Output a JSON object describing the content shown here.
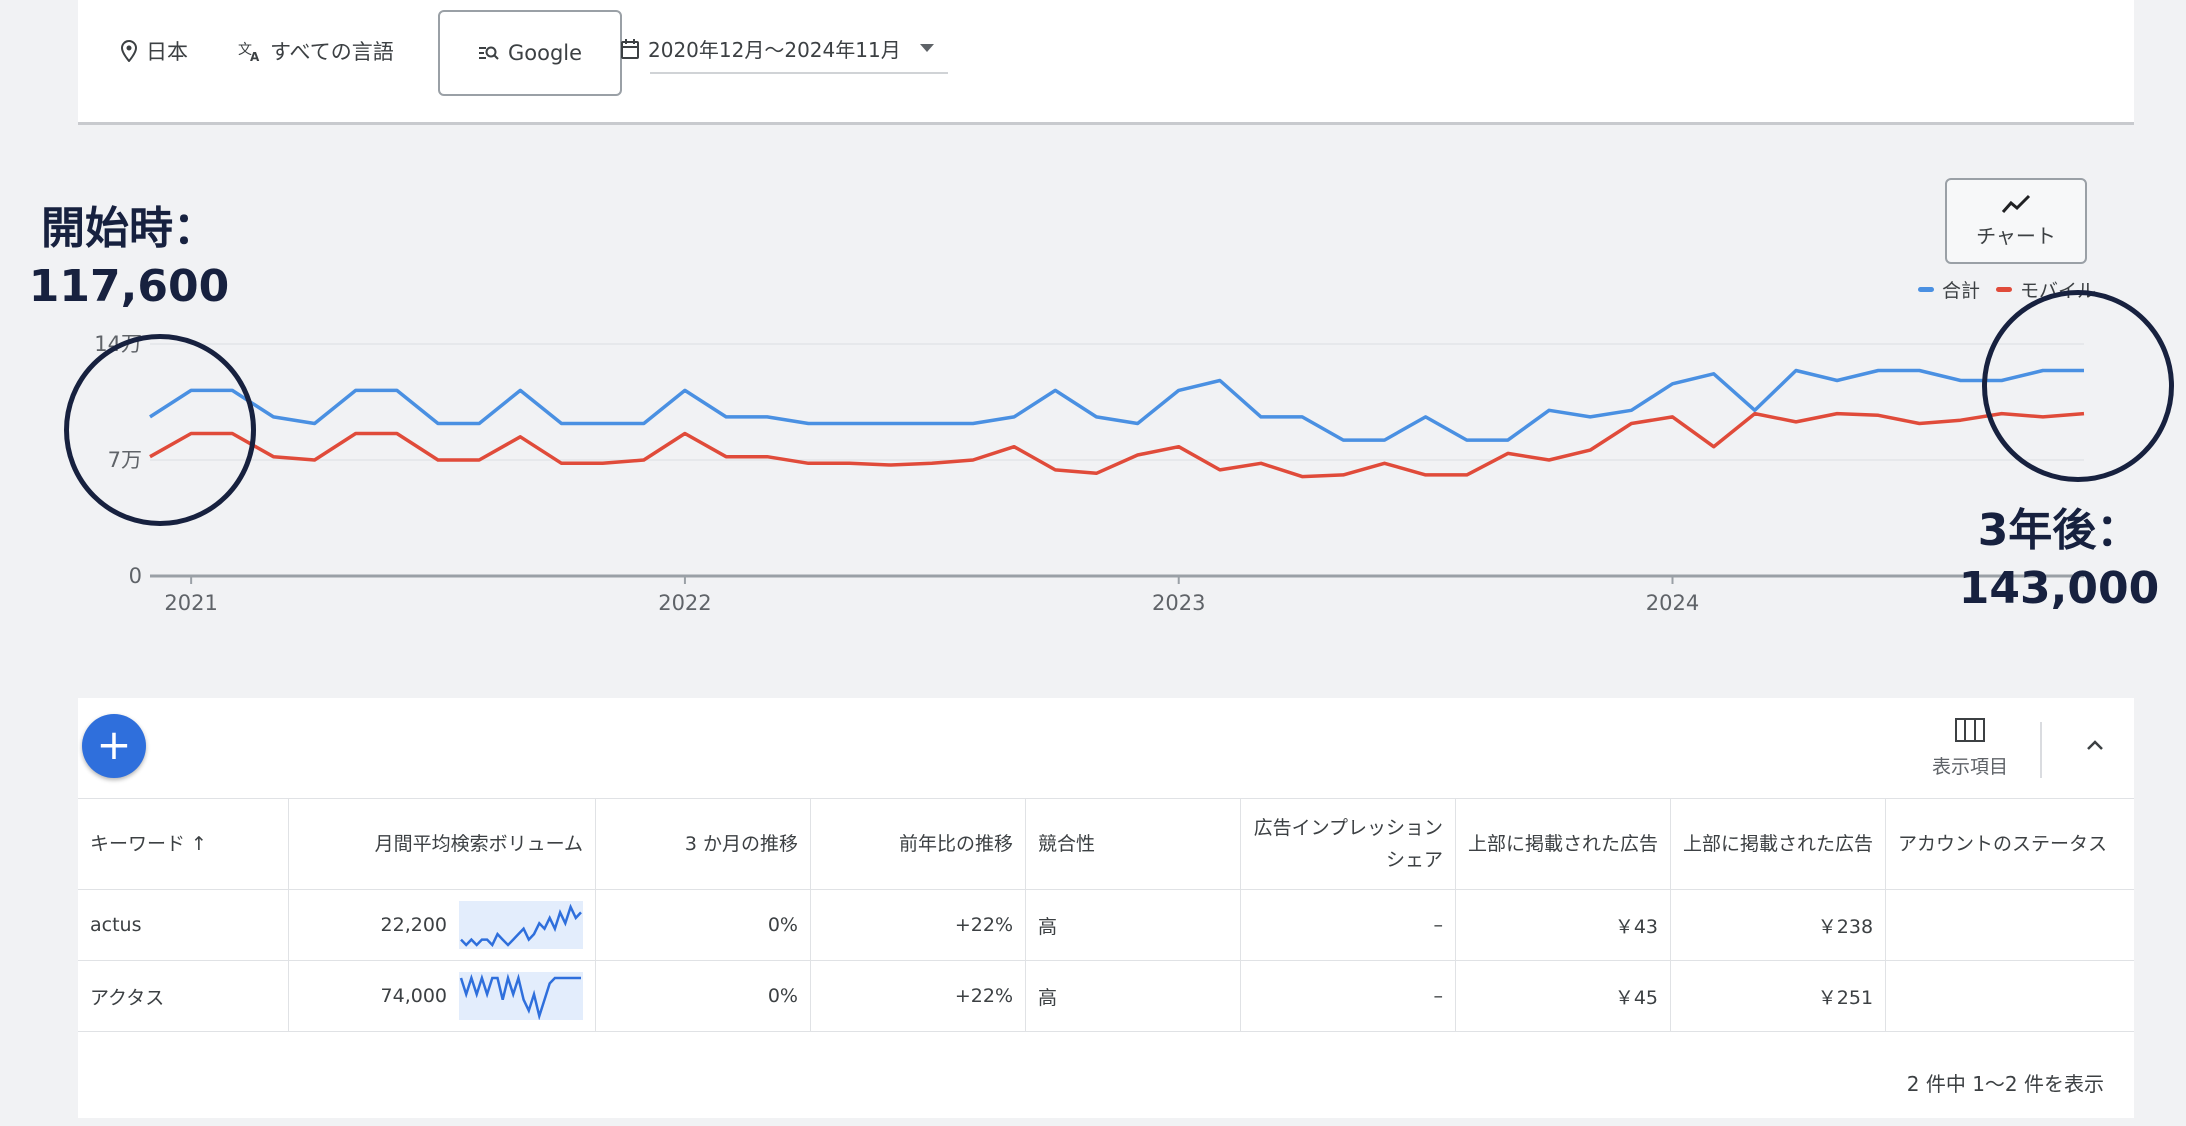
{
  "filters": {
    "location": "日本",
    "language": "すべての言語",
    "search_engine": "Google",
    "date_range": "2020年12月〜2024年11月"
  },
  "chart_toggle_label": "チャート",
  "legend": [
    {
      "name": "合計",
      "color": "#4a90e2"
    },
    {
      "name": "モバイル",
      "color": "#e04b3a"
    }
  ],
  "annotations": {
    "start": "開始時：\n117,600",
    "end": "3年後：\n143,000"
  },
  "chart_data": {
    "type": "line",
    "x_start": "2020-12",
    "x_end": "2024-11",
    "xticks": [
      "2021",
      "2022",
      "2023",
      "2024"
    ],
    "yticks": [
      "0",
      "7万",
      "14万"
    ],
    "ylim": [
      0,
      140000
    ],
    "series": [
      {
        "name": "合計",
        "color": "#4a90e2",
        "values": [
          96000,
          112000,
          112000,
          96000,
          92000,
          112000,
          112000,
          92000,
          92000,
          112000,
          92000,
          92000,
          92000,
          112000,
          96000,
          96000,
          92000,
          92000,
          92000,
          92000,
          92000,
          96000,
          112000,
          96000,
          92000,
          112000,
          118000,
          96000,
          96000,
          82000,
          82000,
          96000,
          82000,
          82000,
          100000,
          96000,
          100000,
          116000,
          122000,
          100000,
          124000,
          118000,
          124000,
          124000,
          118000,
          118000,
          124000,
          124000
        ]
      },
      {
        "name": "モバイル",
        "color": "#e04b3a",
        "values": [
          72000,
          86000,
          86000,
          72000,
          70000,
          86000,
          86000,
          70000,
          70000,
          84000,
          68000,
          68000,
          70000,
          86000,
          72000,
          72000,
          68000,
          68000,
          67000,
          68000,
          70000,
          78000,
          64000,
          62000,
          73000,
          78000,
          64000,
          68000,
          60000,
          61000,
          68000,
          61000,
          61000,
          74000,
          70000,
          76000,
          92000,
          96000,
          78000,
          98000,
          93000,
          98000,
          97000,
          92000,
          94000,
          98000,
          96000,
          98000
        ]
      }
    ]
  },
  "table": {
    "column_toggle_label": "表示項目",
    "headers": [
      "キーワード ↑",
      "月間平均検索ボリューム",
      "3 か月の推移",
      "前年比の推移",
      "競合性",
      "広告インプレッション\nシェア",
      "上部に掲載された広告",
      "上部に掲載された広告",
      "アカウントのステータス"
    ],
    "rows": [
      {
        "keyword": "actus",
        "volume": "22,200",
        "three_month": "0%",
        "yoy": "+22%",
        "competition": "高",
        "impression_share": "–",
        "top_bid_low": "￥43",
        "top_bid_high": "￥238",
        "status": "",
        "trend": [
          3,
          2,
          3,
          2,
          3,
          3,
          2,
          4,
          3,
          2,
          3,
          4,
          5,
          3,
          4,
          6,
          5,
          7,
          5,
          8,
          6,
          9,
          7,
          8
        ]
      },
      {
        "keyword": "アクタス",
        "volume": "74,000",
        "three_month": "0%",
        "yoy": "+22%",
        "competition": "高",
        "impression_share": "–",
        "top_bid_low": "￥45",
        "top_bid_high": "￥251",
        "status": "",
        "trend": [
          9,
          6,
          9,
          6,
          9,
          6,
          9,
          9,
          5,
          9,
          6,
          9,
          5,
          3,
          6,
          2,
          5,
          8,
          9,
          9,
          9,
          9,
          9,
          9
        ]
      }
    ],
    "footer": "2 件中 1〜2 件を表示"
  }
}
